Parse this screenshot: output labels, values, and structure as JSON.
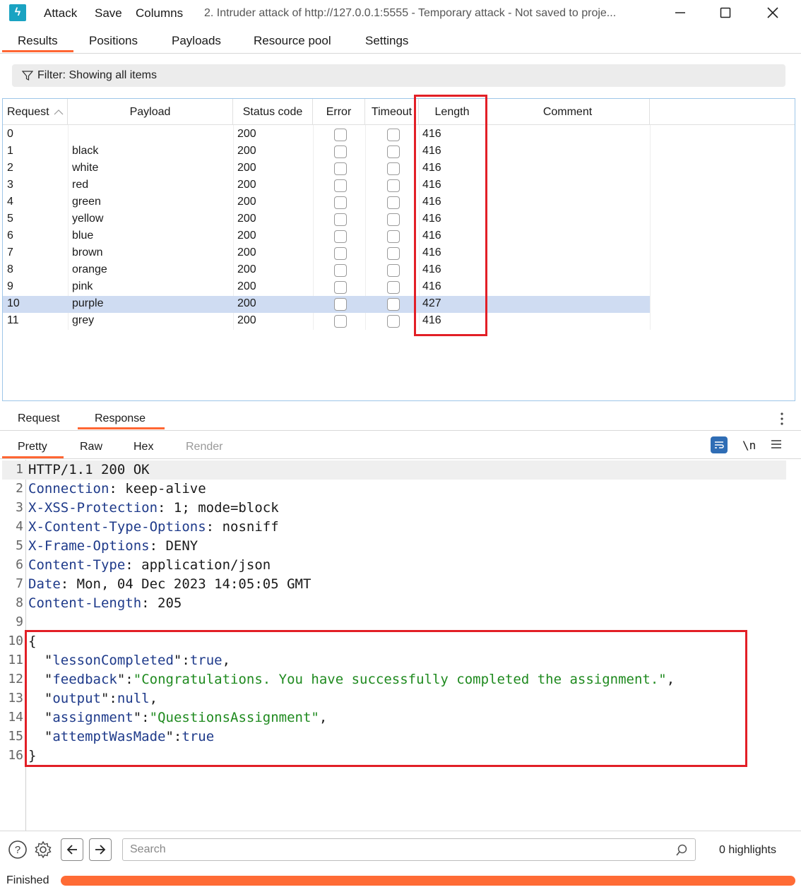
{
  "titlebar": {
    "menu": [
      "Attack",
      "Save",
      "Columns"
    ],
    "title": "2. Intruder attack of http://127.0.0.1:5555 - Temporary attack - Not saved to proje..."
  },
  "main_tabs": [
    "Results",
    "Positions",
    "Payloads",
    "Resource pool",
    "Settings"
  ],
  "filter": {
    "text": "Filter: Showing all items"
  },
  "table": {
    "headers": [
      "Request",
      "Payload",
      "Status code",
      "Error",
      "Timeout",
      "Length",
      "Comment"
    ],
    "rows": [
      {
        "request": "0",
        "payload": "",
        "status": "200",
        "length": "416"
      },
      {
        "request": "1",
        "payload": "black",
        "status": "200",
        "length": "416"
      },
      {
        "request": "2",
        "payload": "white",
        "status": "200",
        "length": "416"
      },
      {
        "request": "3",
        "payload": "red",
        "status": "200",
        "length": "416"
      },
      {
        "request": "4",
        "payload": "green",
        "status": "200",
        "length": "416"
      },
      {
        "request": "5",
        "payload": "yellow",
        "status": "200",
        "length": "416"
      },
      {
        "request": "6",
        "payload": "blue",
        "status": "200",
        "length": "416"
      },
      {
        "request": "7",
        "payload": "brown",
        "status": "200",
        "length": "416"
      },
      {
        "request": "8",
        "payload": "orange",
        "status": "200",
        "length": "416"
      },
      {
        "request": "9",
        "payload": "pink",
        "status": "200",
        "length": "416"
      },
      {
        "request": "10",
        "payload": "purple",
        "status": "200",
        "length": "427"
      },
      {
        "request": "11",
        "payload": "grey",
        "status": "200",
        "length": "416"
      }
    ],
    "selected_row": "10"
  },
  "rr_tabs": [
    "Request",
    "Response"
  ],
  "sub_tabs": [
    "Pretty",
    "Raw",
    "Hex",
    "Render"
  ],
  "toolbar_label_ln": "\\n",
  "response": {
    "status_line": "HTTP/1.1 200 OK",
    "headers": [
      {
        "name": "Connection",
        "value": " keep-alive"
      },
      {
        "name": "X-XSS-Protection",
        "value": " 1; mode=block"
      },
      {
        "name": "X-Content-Type-Options",
        "value": " nosniff"
      },
      {
        "name": "X-Frame-Options",
        "value": " DENY"
      },
      {
        "name": "Content-Type",
        "value": " application/json"
      },
      {
        "name": "Date",
        "value": " Mon, 04 Dec 2023 14:05:05 GMT"
      },
      {
        "name": "Content-Length",
        "value": " 205"
      }
    ],
    "body": {
      "lessonCompleted": "true",
      "feedback": "Congratulations. You have successfully completed the assignment.",
      "output": "null",
      "assignment": "QuestionsAssignment",
      "attemptWasMade": "true"
    }
  },
  "search": {
    "placeholder": "Search",
    "highlights": "0 highlights"
  },
  "status": {
    "text": "Finished",
    "progress": 1.0
  },
  "colors": {
    "accent": "#ff6633",
    "highlight_box": "#e21f26",
    "selected_row": "#cfdcf2",
    "header_key": "#1e3a8a",
    "string": "#1f8a1f"
  }
}
